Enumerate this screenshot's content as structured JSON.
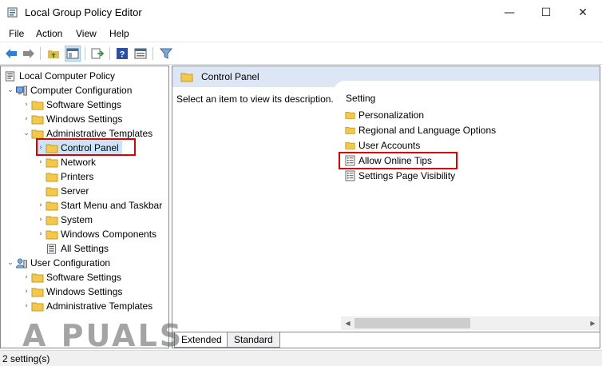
{
  "window": {
    "title": "Local Group Policy Editor",
    "controls": {
      "minimize": "—",
      "maximize": "☐",
      "close": "✕"
    }
  },
  "menu": [
    "File",
    "Action",
    "View",
    "Help"
  ],
  "toolbar": [
    "back-arrow-icon",
    "forward-arrow-icon",
    "up-folder-icon",
    "show-hide-tree-icon",
    "export-list-icon",
    "help-icon",
    "properties-icon",
    "filter-icon"
  ],
  "tree": {
    "root": "Local Computer Policy",
    "computer_config": "Computer Configuration",
    "cc_software": "Software Settings",
    "cc_windows": "Windows Settings",
    "cc_admin": "Administrative Templates",
    "control_panel": "Control Panel",
    "network": "Network",
    "printers": "Printers",
    "server": "Server",
    "start_menu": "Start Menu and Taskbar",
    "system": "System",
    "windows_components": "Windows Components",
    "all_settings": "All Settings",
    "user_config": "User Configuration",
    "uc_software": "Software Settings",
    "uc_windows": "Windows Settings",
    "uc_admin": "Administrative Templates"
  },
  "details": {
    "header": "Control Panel",
    "description_prompt": "Select an item to view its description.",
    "column_header": "Setting",
    "items": [
      "Personalization",
      "Regional and Language Options",
      "User Accounts",
      "Allow Online Tips",
      "Settings Page Visibility"
    ]
  },
  "tabs": {
    "extended": "Extended",
    "standard": "Standard"
  },
  "status": "2 setting(s)",
  "watermark": "A PUALS",
  "colors": {
    "folder": "#f2c94c",
    "header_bg": "#dce6f4",
    "highlight": "#e00000",
    "selection": "#cce4f7"
  }
}
